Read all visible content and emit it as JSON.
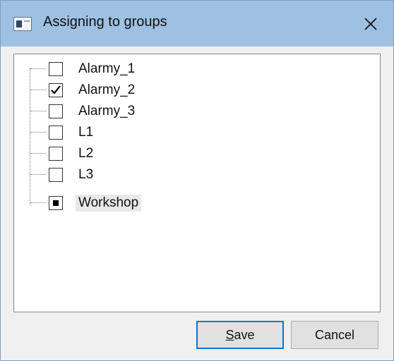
{
  "window": {
    "title": "Assigning to groups",
    "icon": "app-window-icon",
    "close_icon": "close-icon"
  },
  "tree": {
    "items": [
      {
        "label": "Alarmy_1",
        "state": "unchecked"
      },
      {
        "label": "Alarmy_2",
        "state": "checked"
      },
      {
        "label": "Alarmy_3",
        "state": "unchecked"
      },
      {
        "label": "L1",
        "state": "unchecked"
      },
      {
        "label": "L2",
        "state": "unchecked"
      },
      {
        "label": "L3",
        "state": "unchecked"
      },
      {
        "label": "Workshop",
        "state": "indeterminate",
        "selected": true
      }
    ]
  },
  "buttons": {
    "save_mnemonic": "S",
    "save_rest": "ave",
    "cancel_label": "Cancel"
  },
  "colors": {
    "titlebar": "#9ec1e2",
    "default_button_border": "#0078d7",
    "dialog_background": "#f0f0f0"
  }
}
